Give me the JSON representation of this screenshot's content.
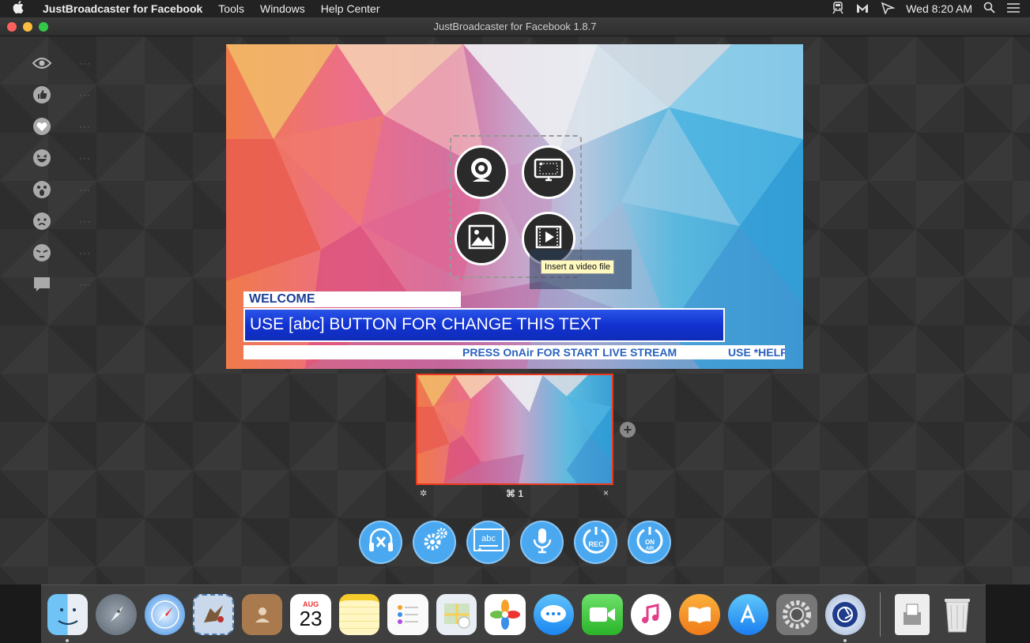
{
  "menubar": {
    "apple": "",
    "app_name": "JustBroadcaster for Facebook",
    "items": [
      "Tools",
      "Windows",
      "Help Center"
    ],
    "clock": "Wed 8:20 AM"
  },
  "window": {
    "title": "JustBroadcaster for Facebook 1.8.7"
  },
  "reactions": [
    {
      "icon": "eye-icon",
      "count": "···"
    },
    {
      "icon": "like-icon",
      "count": "···"
    },
    {
      "icon": "heart-icon",
      "count": "···"
    },
    {
      "icon": "haha-icon",
      "count": "···"
    },
    {
      "icon": "wow-icon",
      "count": "···"
    },
    {
      "icon": "sad-icon",
      "count": "···"
    },
    {
      "icon": "angry-icon",
      "count": "···"
    },
    {
      "icon": "comment-icon",
      "count": "···"
    }
  ],
  "preview": {
    "tooltip": "Insert a video file",
    "welcome": "WELCOME",
    "headline": "USE [abc] BUTTON FOR CHANGE THIS TEXT",
    "ticker_a": "PRESS  OnAir  FOR START LIVE STREAM",
    "ticker_b": "USE *HELP"
  },
  "scene": {
    "shortcut": "⌘ 1",
    "gear": "✲",
    "close": "×",
    "add": "+"
  },
  "toolbar": [
    {
      "name": "audio-mute-button",
      "icon": "headphones-x-icon"
    },
    {
      "name": "settings-button",
      "icon": "gears-icon"
    },
    {
      "name": "text-button",
      "icon": "abc-icon",
      "label": "abc"
    },
    {
      "name": "microphone-button",
      "icon": "microphone-icon"
    },
    {
      "name": "record-button",
      "icon": "rec-icon",
      "label": "REC"
    },
    {
      "name": "onair-button",
      "icon": "onair-icon",
      "label": "ON AIR"
    }
  ],
  "dock": {
    "calendar_month": "AUG",
    "calendar_day": "23"
  },
  "colors": {
    "accent_blue": "#4aa8f0",
    "scene_selected_border": "#e8391f",
    "headline_bar": "#1232d0",
    "welcome_text": "#1a3f96"
  }
}
